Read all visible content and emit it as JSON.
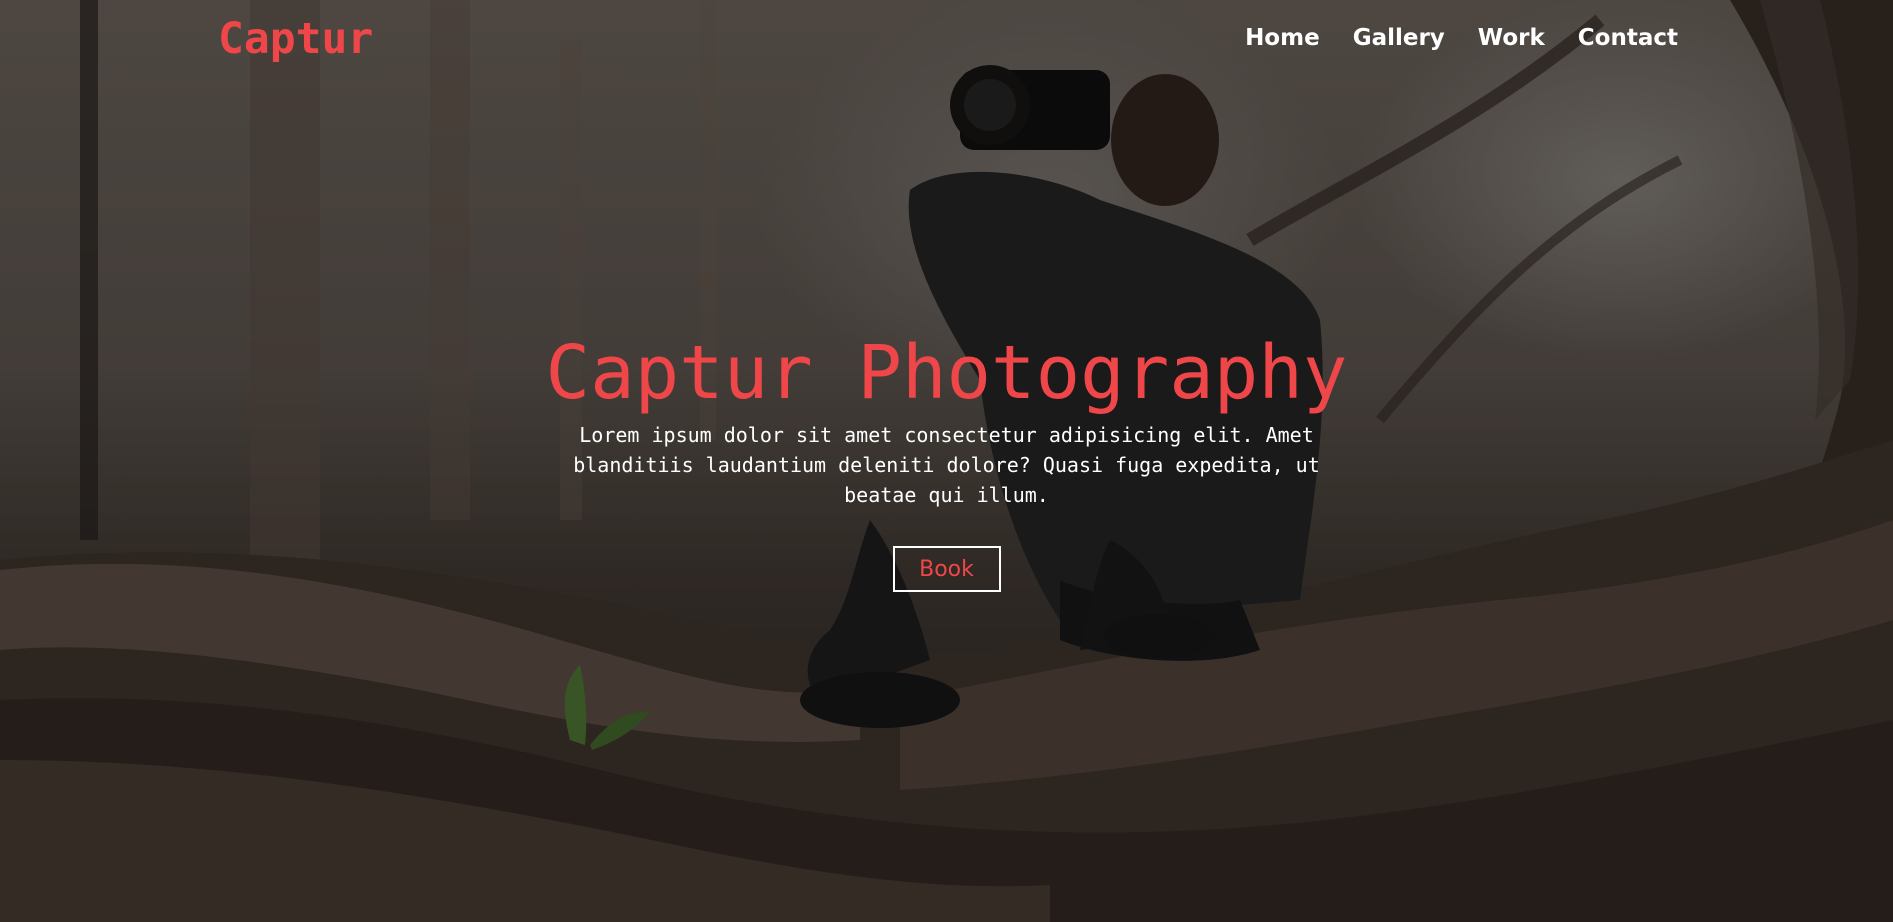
{
  "brand": {
    "logo_text": "Captur",
    "accent_color": "#ef4749"
  },
  "nav": {
    "items": [
      {
        "label": "Home"
      },
      {
        "label": "Gallery"
      },
      {
        "label": "Work"
      },
      {
        "label": "Contact"
      }
    ]
  },
  "hero": {
    "title": "Captur Photography",
    "description": "Lorem ipsum dolor sit amet consectetur adipisicing elit. Amet blanditiis laudantium deleniti dolore? Quasi fuga expedita, ut beatae qui illum.",
    "cta_label": "Book",
    "background_image": "photographer-in-forest-on-tree-roots"
  }
}
